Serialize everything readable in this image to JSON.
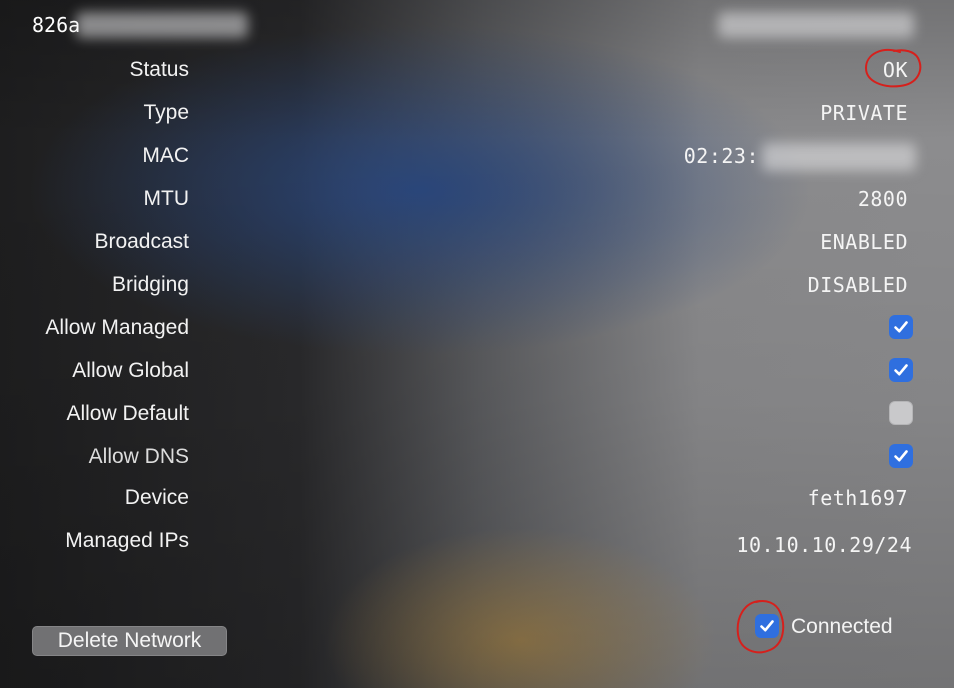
{
  "header": {
    "network_id_prefix": "826a"
  },
  "rows": [
    {
      "label": "Status",
      "value": "OK"
    },
    {
      "label": "Type",
      "value": "PRIVATE"
    },
    {
      "label": "MAC",
      "value": "02:23:"
    },
    {
      "label": "MTU",
      "value": "2800"
    },
    {
      "label": "Broadcast",
      "value": "ENABLED"
    },
    {
      "label": "Bridging",
      "value": "DISABLED"
    },
    {
      "label": "Allow Managed",
      "checked": true
    },
    {
      "label": "Allow Global",
      "checked": true
    },
    {
      "label": "Allow Default",
      "checked": false
    },
    {
      "label": "Allow DNS",
      "checked": true
    },
    {
      "label": "Device",
      "value": "feth1697"
    },
    {
      "label": "Managed IPs",
      "value": "10.10.10.29/24"
    }
  ],
  "footer": {
    "delete_label": "Delete Network",
    "connected_label": "Connected",
    "connected_checked": true
  },
  "colors": {
    "accent": "#2f6fdf",
    "annotation": "#d6201c"
  }
}
